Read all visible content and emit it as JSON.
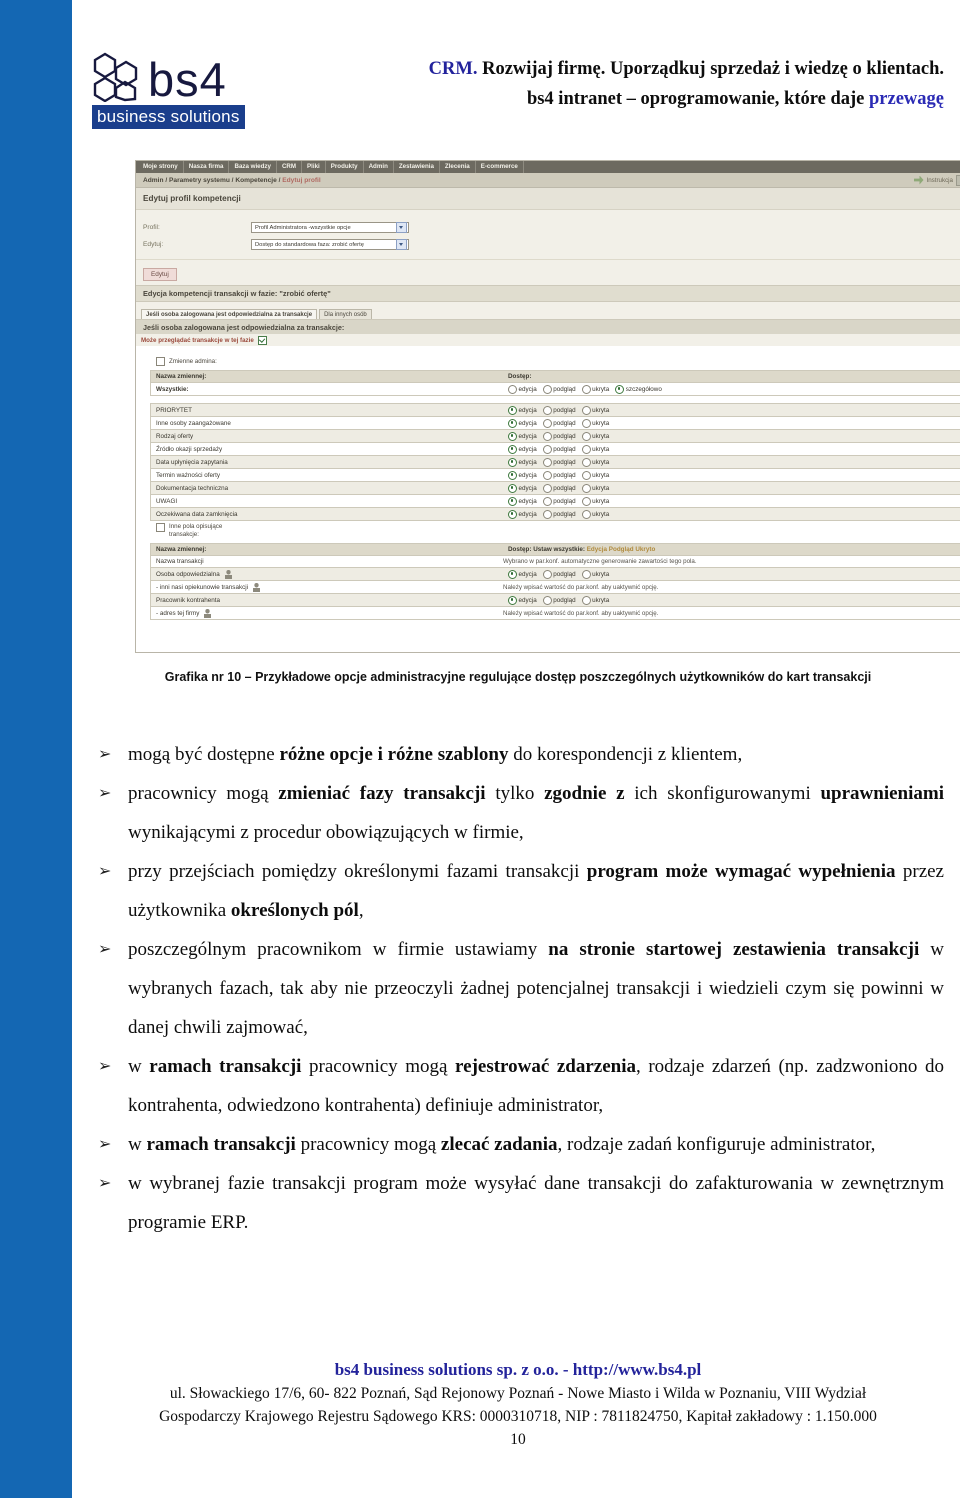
{
  "branding": {
    "logo_text": "bs4",
    "logo_tagline": "business solutions",
    "headline_line1_accent": "CRM.",
    "headline_line1_rest": " Rozwijaj firmę. Uporządkuj sprzedaż i wiedzę o klientach.",
    "headline_line2_plain": "bs4 intranet – oprogramowanie, które daje ",
    "headline_line2_accent": "przewagę",
    "accent_color": "#22229c",
    "logo_tag_bg": "#1a3e8c",
    "left_bar_color": "#1467b3"
  },
  "app": {
    "nav_items": [
      "Moje strony",
      "Nasza firma",
      "Baza wiedzy",
      "CRM",
      "Pliki",
      "Produkty",
      "Admin",
      "Zestawienia",
      "Zlecenia",
      "E-commerce"
    ],
    "breadcrumb_prefix": "Admin / Parametry systemu / Kompetencje / ",
    "breadcrumb_current": "Edytuj profil",
    "help_link": "Instrukcja",
    "page_title": "Edytuj profil kompetencji",
    "form": {
      "profile_label": "Profil:",
      "profile_value": "Profil Administratora -wszystkie opcje",
      "edit_label": "Edytuj:",
      "edit_value": "Dostęp do standardowa faza: zrobić ofertę"
    },
    "edit_button": "Edytuj",
    "section_title": "Edycja kompetencji transakcji w fazie: \"zrobić ofertę\"",
    "tabs": [
      {
        "label": "Jeśli osoba zalogowana jest odpowiedzialna za transakcje",
        "active": true
      },
      {
        "label": "Dla innych osób",
        "active": false
      }
    ],
    "subsection_title": "Jeśli osoba zalogowana jest odpowiedzialna za transakcje:",
    "can_view_label": "Może przeglądać transakcje w tej fazie",
    "can_view_checked": true,
    "admin_vars_label": "Zmienne admina:",
    "admin_vars_checked": false,
    "other_fields_label_line1": "Inne pola opisujące",
    "other_fields_label_line2": "transakcje:",
    "other_fields_checked": false,
    "radio_labels": {
      "edit": "edycja",
      "preview": "podgląd",
      "hidden": "ukryta",
      "detailed": "szczegółowo"
    },
    "table1": {
      "col_name": "Nazwa zmiennej:",
      "col_access": "Dostęp:",
      "all_row_label": "Wszystkie:",
      "all_row_selected": "detailed",
      "rows": [
        {
          "name": "PRIORYTET",
          "selected": "edit"
        },
        {
          "name": "Inne osoby zaangażowane",
          "selected": "edit"
        },
        {
          "name": "Rodzaj oferty",
          "selected": "edit"
        },
        {
          "name": "Źródło okazji sprzedaży",
          "selected": "edit"
        },
        {
          "name": "Data upłynięcia zapytania",
          "selected": "edit"
        },
        {
          "name": "Termin ważności oferty",
          "selected": "edit"
        },
        {
          "name": "Dokumentacja techniczna",
          "selected": "edit"
        },
        {
          "name": "UWAGI",
          "selected": "edit"
        },
        {
          "name": "Oczekiwana data zamknięcia",
          "selected": "edit"
        }
      ]
    },
    "table2": {
      "col_name": "Nazwa zmiennej:",
      "col_access_prefix": "Dostęp:  Ustaw wszystkie:",
      "set_all_links": "Edycja Podgląd Ukryto",
      "rows": [
        {
          "name": "Nazwa transakcji",
          "kind": "note",
          "note": "Wybrano w par.konf. automatyczne generowanie zawartości tego pola."
        },
        {
          "name": "Osoba odpowiedzialna",
          "kind": "radios",
          "selected": "edit",
          "has_person_icon": true
        },
        {
          "name": "- inni nasi opiekunowie transakcji",
          "kind": "note",
          "note": "Należy wpisać wartość do par.konf. aby uaktywnić opcję.",
          "has_person_icon": true
        },
        {
          "name": "Pracownik kontrahenta",
          "kind": "radios",
          "selected": "edit",
          "has_person_icon": false
        },
        {
          "name": "- adres tej firmy",
          "kind": "note",
          "note": "Należy wpisać wartość do par.konf. aby uaktywnić opcję.",
          "has_person_icon": true
        }
      ]
    }
  },
  "caption": "Grafika nr 10 – Przykładowe opcje administracyjne regulujące dostęp poszczególnych użytkowników do kart transakcji",
  "bullets": [
    {
      "marker": "➢",
      "segments": [
        {
          "t": "mogą być dostępne ",
          "b": false
        },
        {
          "t": "różne opcje i różne szablony",
          "b": true
        },
        {
          "t": " do korespondencji z klientem,",
          "b": false
        }
      ]
    },
    {
      "marker": "➢",
      "segments": [
        {
          "t": "pracownicy mogą ",
          "b": false
        },
        {
          "t": "zmieniać fazy transakcji",
          "b": true
        },
        {
          "t": " tylko ",
          "b": false
        },
        {
          "t": "zgodnie z",
          "b": true
        },
        {
          "t": " ich skonfigurowanymi ",
          "b": false
        },
        {
          "t": "uprawnieniami",
          "b": true
        },
        {
          "t": " wynikającymi z procedur obowiązujących w firmie,",
          "b": false
        }
      ]
    },
    {
      "marker": "➢",
      "segments": [
        {
          "t": "przy przejściach pomiędzy określonymi fazami transakcji ",
          "b": false
        },
        {
          "t": "program może wymagać wypełnienia",
          "b": true
        },
        {
          "t": " przez użytkownika ",
          "b": false
        },
        {
          "t": "określonych pól",
          "b": true
        },
        {
          "t": ",",
          "b": false
        }
      ]
    },
    {
      "marker": "➢",
      "segments": [
        {
          "t": "poszczególnym pracownikom w firmie ustawiamy ",
          "b": false
        },
        {
          "t": "na stronie startowej zestawienia transakcji",
          "b": true
        },
        {
          "t": " w wybranych fazach, tak aby nie przeoczyli żadnej potencjalnej transakcji i wiedzieli czym się powinni w danej chwili zajmować,",
          "b": false
        }
      ]
    },
    {
      "marker": "➢",
      "segments": [
        {
          "t": "w ",
          "b": false
        },
        {
          "t": "ramach transakcji",
          "b": true
        },
        {
          "t": " pracownicy mogą ",
          "b": false
        },
        {
          "t": "rejestrować zdarzenia",
          "b": true
        },
        {
          "t": ", rodzaje zdarzeń (np. zadzwoniono do kontrahenta, odwiedzono kontrahenta) definiuje administrator,",
          "b": false
        }
      ]
    },
    {
      "marker": "➢",
      "segments": [
        {
          "t": "w ",
          "b": false
        },
        {
          "t": "ramach transakcji",
          "b": true
        },
        {
          "t": " pracownicy mogą ",
          "b": false
        },
        {
          "t": "zlecać zadania",
          "b": true
        },
        {
          "t": ", rodzaje zadań konfiguruje administrator,",
          "b": false
        }
      ]
    },
    {
      "marker": "➢",
      "segments": [
        {
          "t": "w wybranej fazie transakcji program może wysyłać dane transakcji do zafakturowania w zewnętrznym programie ERP.",
          "b": false
        }
      ]
    }
  ],
  "footer": {
    "company_line": "bs4 business solutions sp. z o.o. - http://www.bs4.pl",
    "address_line1": "ul. Słowackiego 17/6, 60- 822 Poznań, Sąd Rejonowy Poznań - Nowe Miasto i Wilda w Poznaniu, VIII Wydział",
    "address_line2": "Gospodarczy Krajowego Rejestru Sądowego KRS: 0000310718, NIP : 7811824750, Kapitał zakładowy : 1.150.000",
    "page_number": "10"
  }
}
